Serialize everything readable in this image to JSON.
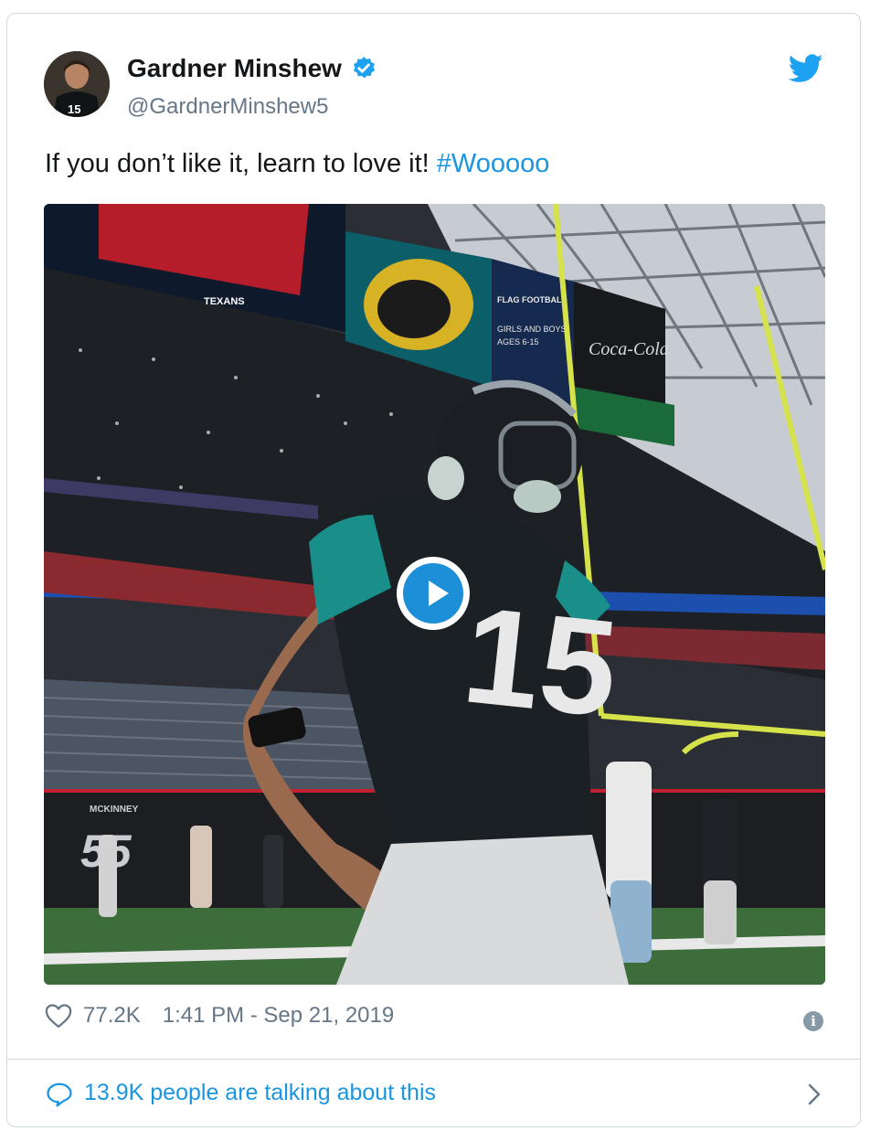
{
  "tweet": {
    "author": {
      "name": "Gardner Minshew",
      "handle": "@GardnerMinshew5",
      "verified": true,
      "avatar_icon": "avatar-photo"
    },
    "text_main": "If you don’t like it, learn to love it! ",
    "hashtag": "#Wooooo",
    "media": {
      "type": "video",
      "play_icon": "play-icon",
      "jersey_number": "15",
      "scoreboard_lines": [
        "FLAG FOOTBALL",
        "GIRLS AND BOYS",
        "AGES 6-15"
      ],
      "sponsor": "Coca-Cola",
      "banner_text": "TEXANS",
      "sideline_name": "MCKINNEY",
      "sideline_number": "55"
    },
    "likes": "77.2K",
    "timestamp": "1:41 PM - Sep 21, 2019",
    "conversation": "13.9K people are talking about this"
  },
  "colors": {
    "link_blue": "#1b95e0",
    "verified_blue": "#1da1f2",
    "muted_gray": "#657786",
    "border": "#cfd9de",
    "play_blue": "#1d8ed8"
  },
  "icons": {
    "twitter": "twitter-bird-icon",
    "verified": "verified-badge-icon",
    "like": "heart-icon",
    "info": "info-icon",
    "reply": "speech-bubble-icon",
    "chevron": "chevron-right-icon"
  }
}
